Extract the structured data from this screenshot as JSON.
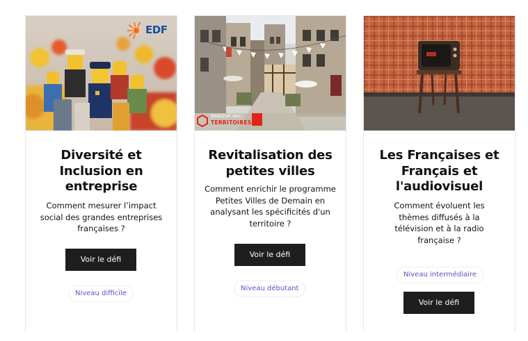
{
  "cards": [
    {
      "title": "Diversité et Inclusion en entreprise",
      "description": "Comment mesurer l’impact social des grandes entreprises françaises ?",
      "button_label": "Voir le défi",
      "level": "Niveau difficile",
      "logo": "EDF"
    },
    {
      "title": "Revitalisation des petites villes",
      "description": "Comment enrichir le programme Petites Villes de Demain en analysant les spécificités d'un territoire ?",
      "button_label": "Voir le défi",
      "level": "Niveau débutant",
      "logo_line1": "BANQUE des",
      "logo_line2": "TERRITOIRES"
    },
    {
      "title": "Les Françaises et Français et l'audiovisuel",
      "description": "Comment évoluent les thèmes diffusés à la télévision et à la radio française ?",
      "button_label": "Voir le défi",
      "level": "Niveau intermédiaire"
    }
  ],
  "colors": {
    "button_bg": "#1e1e1e",
    "badge_text": "#6a4bc9",
    "edf_orange": "#ff6a00",
    "edf_blue": "#1a4fa0",
    "bdt_red": "#e2231a"
  },
  "icons": [
    "edf-logo",
    "banque-des-territoires-logo"
  ]
}
